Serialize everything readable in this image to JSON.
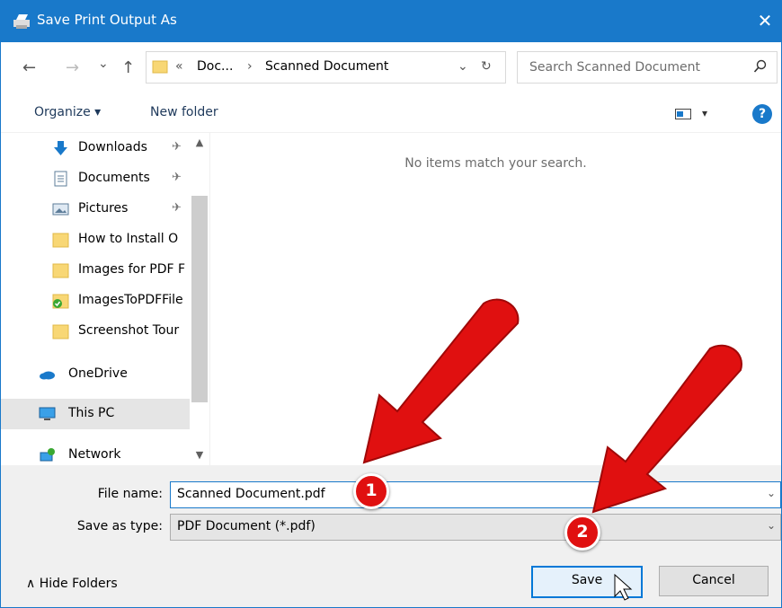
{
  "window": {
    "title": "Save Print Output As",
    "close_glyph": "✕"
  },
  "address": {
    "back_glyph": "←",
    "forward_glyph": "→",
    "recent_glyph": "⌄",
    "up_glyph": "↑",
    "overflow_glyph": "«",
    "crumb1": "Doc...",
    "crumb_sep": "›",
    "crumb2": "Scanned Document",
    "dropdown_glyph": "⌄",
    "refresh_glyph": "↻"
  },
  "search": {
    "placeholder": "Search Scanned Document"
  },
  "toolbar": {
    "organize": "Organize ▾",
    "new_folder": "New folder",
    "view_dropdown_glyph": "▾",
    "help_glyph": "?"
  },
  "nav": {
    "pin_glyph": "✈",
    "items": [
      {
        "label": "Downloads",
        "icon": "downloads-icon",
        "pinned": true
      },
      {
        "label": "Documents",
        "icon": "documents-icon",
        "pinned": true
      },
      {
        "label": "Pictures",
        "icon": "pictures-icon",
        "pinned": true
      },
      {
        "label": "How to Install O",
        "icon": "folder-icon"
      },
      {
        "label": "Images for PDF F",
        "icon": "folder-icon"
      },
      {
        "label": "ImagesToPDFFile",
        "icon": "synced-folder-icon"
      },
      {
        "label": "Screenshot Tour",
        "icon": "folder-icon"
      },
      {
        "label": "OneDrive",
        "icon": "onedrive-icon"
      },
      {
        "label": "This PC",
        "icon": "this-pc-icon",
        "selected": true
      },
      {
        "label": "Network",
        "icon": "network-icon"
      }
    ],
    "scroll_up_glyph": "▲",
    "scroll_down_glyph": "▼"
  },
  "content": {
    "empty_message": "No items match your search."
  },
  "form": {
    "file_name_label": "File name:",
    "file_name_value": "Scanned Document.pdf",
    "save_type_label": "Save as type:",
    "save_type_value": "PDF Document (*.pdf)",
    "dropdown_glyph": "⌄"
  },
  "footer": {
    "hide_folders": "∧  Hide Folders",
    "save_label": "Save",
    "cancel_label": "Cancel"
  },
  "annotations": {
    "badge1": "1",
    "badge2": "2",
    "arrow_color": "#e01010"
  },
  "colors": {
    "accent": "#1979ca",
    "folder": "#f8d775",
    "arrow": "#e01010"
  }
}
